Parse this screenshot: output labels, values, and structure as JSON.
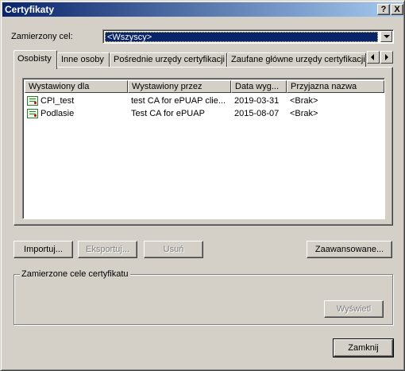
{
  "window": {
    "title": "Certyfikaty",
    "help_glyph": "?",
    "close_glyph": "X"
  },
  "purpose": {
    "label": "Zamierzony cel:",
    "value": "<Wszyscy>"
  },
  "tabs": [
    {
      "label": "Osobisty",
      "active": true
    },
    {
      "label": "Inne osoby",
      "active": false
    },
    {
      "label": "Pośrednie urzędy certyfikacji",
      "active": false
    },
    {
      "label": "Zaufane główne urzędy certyfikacji",
      "active": false
    }
  ],
  "list": {
    "columns": [
      "Wystawiony dla",
      "Wystawiony przez",
      "Data wyg...",
      "Przyjazna nazwa"
    ],
    "rows": [
      {
        "issued_to": "CPI_test",
        "issued_by": "test CA for ePUAP clie...",
        "expiry": "2019-03-31",
        "friendly": "<Brak>",
        "icon": "certificate-icon"
      },
      {
        "issued_to": "Podlasie",
        "issued_by": "Test CA for ePUAP",
        "expiry": "2015-08-07",
        "friendly": "<Brak>",
        "icon": "certificate-icon"
      }
    ]
  },
  "buttons": {
    "import": "Importuj...",
    "export": "Eksportuj...",
    "remove": "Usuń",
    "advanced": "Zaawansowane...",
    "view": "Wyświetl",
    "close": "Zamknij"
  },
  "group": {
    "title": "Zamierzone cele certyfikatu"
  },
  "colors": {
    "titlebar_start": "#0a246a",
    "titlebar_end": "#a6caf0",
    "face": "#d4d0c8",
    "selection": "#0a246a"
  }
}
